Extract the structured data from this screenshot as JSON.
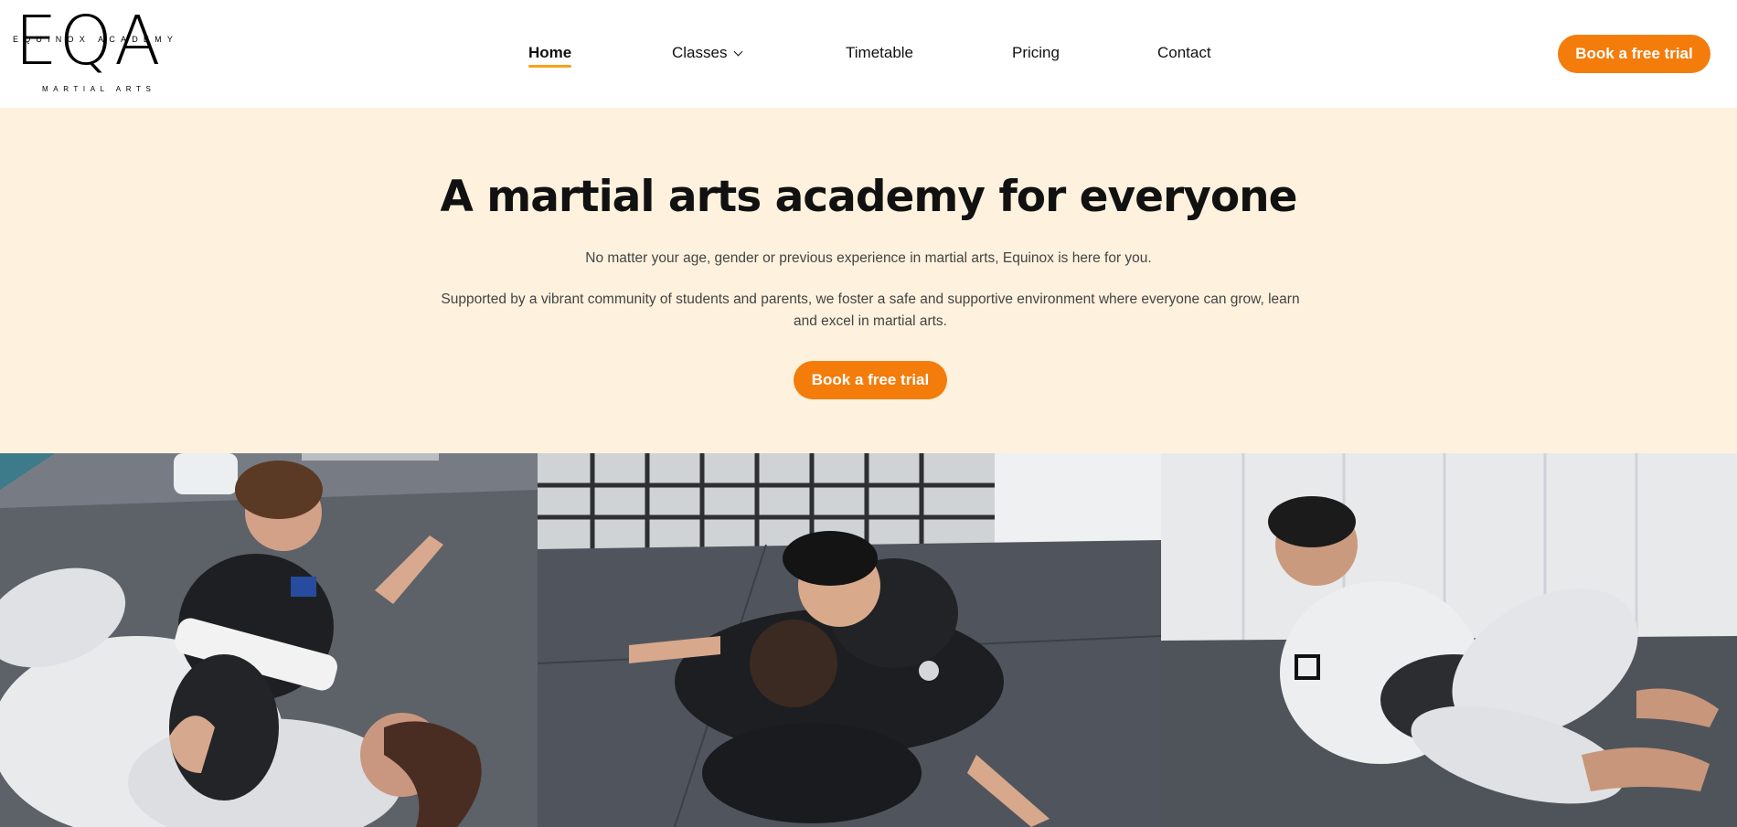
{
  "header": {
    "logo": {
      "mark": "EQA",
      "academy": "EQUINOX ACADEMY",
      "subtitle": "MARTIAL ARTS"
    },
    "nav": [
      {
        "label": "Home",
        "active": true
      },
      {
        "label": "Classes",
        "has_dropdown": true
      },
      {
        "label": "Timetable"
      },
      {
        "label": "Pricing"
      },
      {
        "label": "Contact"
      }
    ],
    "cta_label": "Book a free trial"
  },
  "hero": {
    "title_main": "A martial arts academy for",
    "title_highlight": "everyone",
    "paragraph1": "No matter your age, gender or previous experience in martial arts, Equinox is here for you.",
    "paragraph2": "Supported by a vibrant community of students and parents, we foster a safe and supportive environment where everyone can grow, learn and excel in martial arts.",
    "cta_label": "Book a free trial"
  },
  "colors": {
    "accent": "#f47c0b",
    "underline": "#f39a11",
    "hero_bg": "#fef2de"
  }
}
